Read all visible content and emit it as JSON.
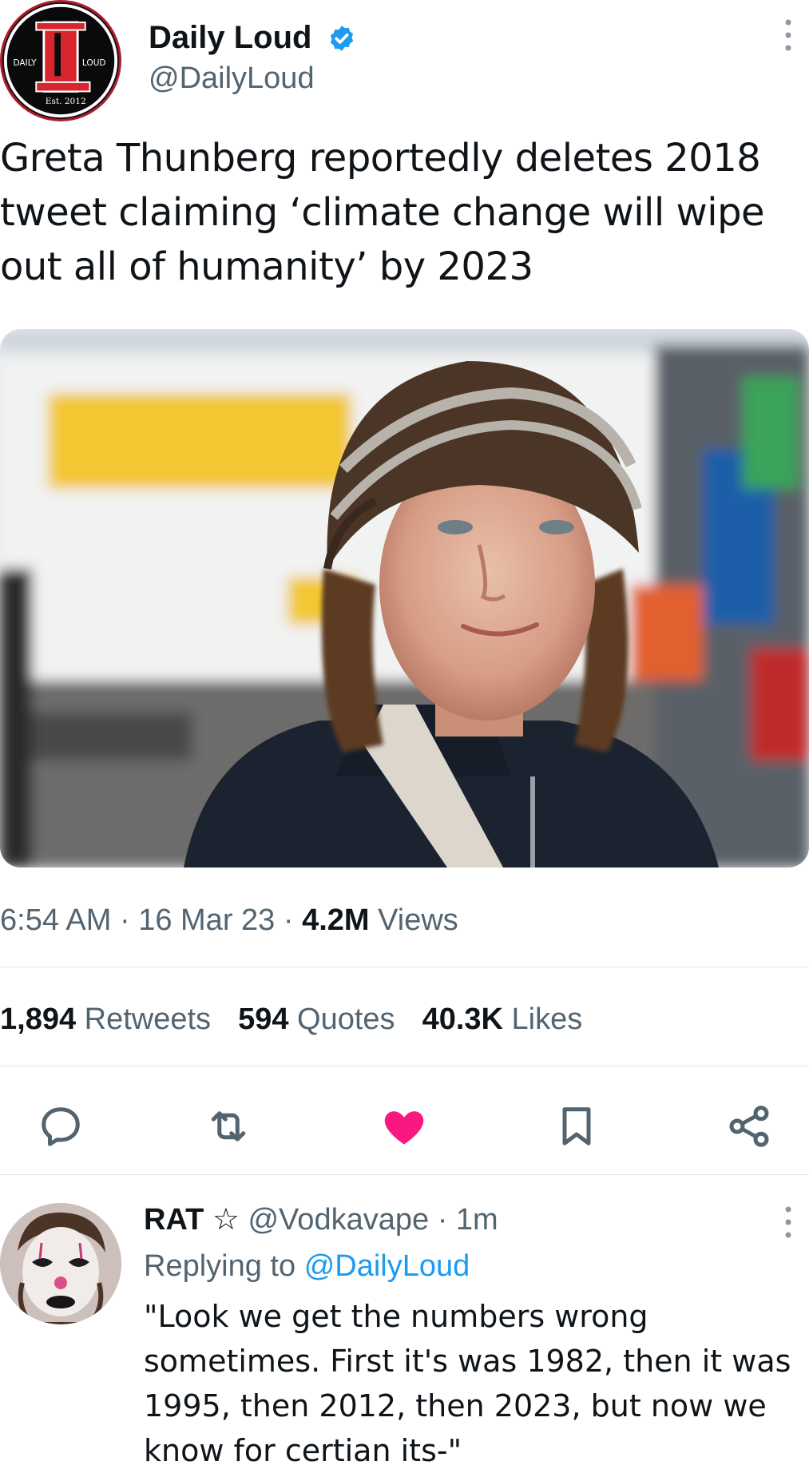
{
  "tweet": {
    "author_name": "Daily Loud",
    "handle": "@DailyLoud",
    "logo": {
      "left_text": "DAILY",
      "right_text": "LOUD",
      "bottom_text": "Est. 2012"
    },
    "text": "Greta Thunberg reportedly deletes 2018 tweet claiming ‘climate change will wipe out all of humanity’ by 2023",
    "time": "6:54 AM",
    "sep": "·",
    "date": "16 Mar 23",
    "views_count": "4.2M",
    "views_label": "Views",
    "retweets_count": "1,894",
    "retweets_label": "Retweets",
    "quotes_count": "594",
    "quotes_label": "Quotes",
    "likes_count": "40.3K",
    "likes_label": "Likes"
  },
  "actions": [
    {
      "icon": "reply-icon"
    },
    {
      "icon": "retweet-icon"
    },
    {
      "icon": "heart-icon",
      "active": true
    },
    {
      "icon": "bookmark-icon"
    },
    {
      "icon": "share-icon"
    }
  ],
  "reply": {
    "name": "RAT",
    "star": "☆",
    "handle": "@Vodkavape",
    "sep": "·",
    "time": "1m",
    "replying_prefix": "Replying to",
    "replying_handle": "@DailyLoud",
    "text": "\"Look we get the numbers wrong sometimes. First it's was 1982, then it was 1995, then 2012, then 2023, but now we know for certian its-\""
  },
  "colors": {
    "verified": "#1d9bf0",
    "link": "#1d9bf0",
    "heart": "#f91880",
    "secondary_text": "#536471",
    "logo_red": "#d7262e"
  }
}
